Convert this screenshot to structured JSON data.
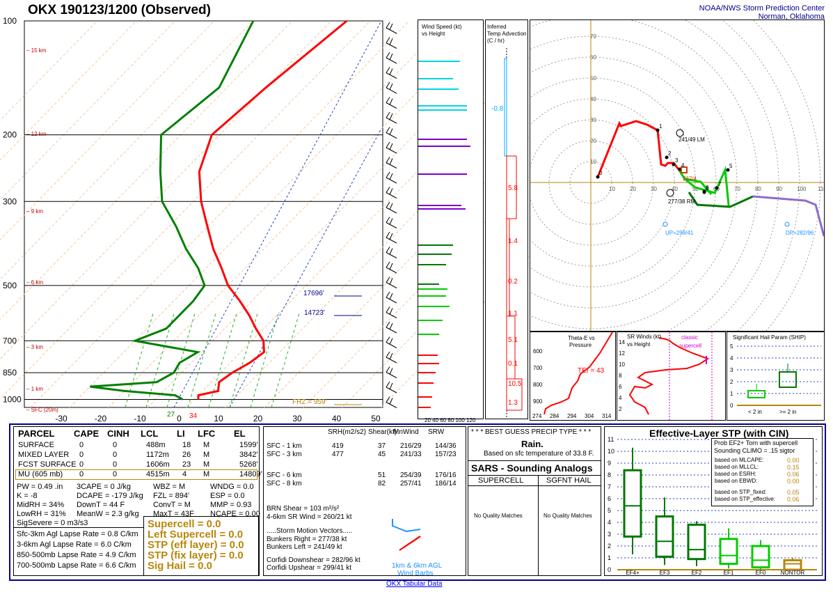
{
  "header": {
    "title": "OKX   190123/1200  (Observed)",
    "org_line1": "NOAA/NWS Storm Prediction Center",
    "org_line2": "Norman, Oklahoma"
  },
  "colors": {
    "temp": "#ff0000",
    "dewp": "#008000",
    "frame": "#00008b",
    "gold": "#b8860b"
  },
  "skewt": {
    "pressure_ticks": [
      "100",
      "200",
      "300",
      "500",
      "700",
      "850",
      "1000"
    ],
    "temp_ticks": [
      "-30",
      "-20",
      "-10",
      "0",
      "10",
      "20",
      "30",
      "40",
      "50"
    ],
    "height_labels": [
      "15 km",
      "12 km",
      "9 km",
      "6 km",
      "3 km",
      "1 km",
      "SFC (20m)"
    ],
    "surface_labels": {
      "dew": "27",
      "temp": "34"
    },
    "lines": {
      "a": "17696'",
      "b": "14723'",
      "frz": "FRZ = 959'"
    }
  },
  "chart_data": [
    {
      "type": "line",
      "title": "Skew-T log-P",
      "xlabel": "",
      "ylabel": "",
      "series": [
        {
          "name": "Temperature",
          "values": [
            [
              1000,
              1
            ],
            [
              975,
              0
            ],
            [
              950,
              4
            ],
            [
              925,
              3
            ],
            [
              900,
              2
            ],
            [
              850,
              3
            ],
            [
              800,
              5
            ],
            [
              750,
              6
            ],
            [
              700,
              3
            ],
            [
              650,
              -2
            ],
            [
              600,
              -7
            ],
            [
              550,
              -13
            ],
            [
              500,
              -20
            ],
            [
              450,
              -26
            ],
            [
              400,
              -33
            ],
            [
              350,
              -40
            ],
            [
              300,
              -48
            ],
            [
              250,
              -56
            ],
            [
              200,
              -62
            ],
            [
              150,
              -60
            ],
            [
              100,
              -56
            ]
          ]
        },
        {
          "name": "Dewpoint",
          "values": [
            [
              1000,
              -3
            ],
            [
              975,
              -6
            ],
            [
              950,
              -20
            ],
            [
              925,
              -30
            ],
            [
              900,
              -14
            ],
            [
              850,
              -12
            ],
            [
              800,
              -13
            ],
            [
              750,
              -11
            ],
            [
              700,
              -30
            ],
            [
              650,
              -25
            ],
            [
              600,
              -25
            ],
            [
              550,
              -25
            ],
            [
              500,
              -26
            ],
            [
              450,
              -32
            ],
            [
              400,
              -40
            ],
            [
              350,
              -48
            ],
            [
              300,
              -58
            ],
            [
              250,
              -66
            ],
            [
              200,
              -75
            ],
            [
              150,
              -72
            ],
            [
              100,
              -80
            ]
          ]
        }
      ]
    },
    {
      "type": "line",
      "title": "Hodograph",
      "series": [
        {
          "name": "Hodograph",
          "values": [
            [
              0,
              0
            ],
            [
              3,
              2
            ],
            [
              2,
              6
            ],
            [
              1,
              10
            ],
            [
              3,
              12
            ],
            [
              5,
              14
            ],
            [
              6,
              15
            ],
            [
              7,
              16
            ],
            [
              8,
              16
            ],
            [
              9,
              17
            ],
            [
              10,
              18
            ],
            [
              11,
              19
            ],
            [
              12,
              21
            ],
            [
              13,
              22
            ]
          ]
        }
      ]
    },
    {
      "type": "bar",
      "title": "Significant Hail Param (SHIP)",
      "categories": [
        "< 2 in",
        ">= 2 in"
      ],
      "values": [
        0.6,
        2.1
      ],
      "ylim": [
        0,
        5
      ]
    },
    {
      "type": "bar",
      "title": "Effective-Layer STP (with CIN)",
      "categories": [
        "EF4+",
        "EF3",
        "EF2",
        "EF1",
        "EF0",
        "NONTOR"
      ],
      "values": [
        5.4,
        2.4,
        1.7,
        1.2,
        0.8,
        0.5
      ],
      "ylim": [
        0,
        11
      ]
    }
  ],
  "wind_panel": {
    "title1": "Wind Speed (kt)",
    "title2": "vs Height",
    "axis": [
      "20",
      "40",
      "60",
      "80",
      "100",
      "120"
    ]
  },
  "adv_panel": {
    "title1": "Inferred",
    "title2": "Temp Advection",
    "title3": "(C / hr)",
    "values": [
      "-0.8",
      "5.8",
      "1.4",
      "0.2",
      "1.1",
      "5.1",
      "0.1",
      "10.5",
      "1.3"
    ]
  },
  "hodo": {
    "rings": [
      "10",
      "20",
      "30",
      "40",
      "50",
      "60",
      "70",
      "80",
      "90",
      "100",
      "110"
    ],
    "points": [
      "0",
      "1",
      "2",
      "3",
      "4",
      "5",
      "6",
      "7",
      "8"
    ],
    "lm": "241/49 LM",
    "rm": "277/38 RM",
    "mean": "262/4",
    "up": "UP=299/41",
    "dp": "DP=282/96"
  },
  "theta_panel": {
    "title1": "Theta-E vs",
    "title2": "Pressure",
    "tei": "TEI = 43",
    "yticks": [
      "600",
      "700",
      "800",
      "900"
    ],
    "xticks": [
      "274",
      "284",
      "294",
      "304",
      "314"
    ]
  },
  "srwind_panel": {
    "title1": "SR Winds (kt)",
    "title2": "vs Height",
    "classic": "classic",
    "supercell": "supercell",
    "yticks": [
      "14",
      "12",
      "10",
      "8",
      "6",
      "4",
      "2"
    ]
  },
  "ship_panel": {
    "title": "Significant Hail Param (SHIP)",
    "yticks": [
      "5",
      "4",
      "3",
      "2",
      "1",
      "0"
    ],
    "cats": [
      "< 2 in",
      ">= 2 in"
    ]
  },
  "parcel_table": {
    "headers": [
      "PARCEL",
      "CAPE",
      "CINH",
      "LCL",
      "LI",
      "LFC",
      "EL"
    ],
    "rows": [
      [
        "SURFACE",
        "0",
        "0",
        "488m",
        "18",
        "M",
        "1599'"
      ],
      [
        "MIXED LAYER",
        "0",
        "0",
        "1172m",
        "26",
        "M",
        "3842'"
      ],
      [
        "FCST SURFACE",
        "0",
        "0",
        "1606m",
        "23",
        "M",
        "5268'"
      ],
      [
        "MU   (605 mb)",
        "0",
        "0",
        "4515m",
        "4",
        "M",
        "14809'"
      ]
    ]
  },
  "indices": {
    "c1": [
      "PW = 0.49 .in",
      "K = -8",
      "MidRH = 34%",
      "LowRH = 31%",
      "SigSevere = 0 m3/s3"
    ],
    "c2": [
      "3CAPE = 0 J/kg",
      "DCAPE = -179 J/kg",
      "DownT = 44 F",
      "MeanW = 2.3 g/kg"
    ],
    "c3": [
      "WBZ = M",
      "FZL = 894'",
      "ConvT = M",
      "MaxT = 43F"
    ],
    "c4": [
      "WNDG = 0.0",
      "ESP = 0.0",
      "MMP = 0.93",
      "NCAPE = 0.00"
    ]
  },
  "lapse": [
    "Sfc-3km Agl Lapse Rate =   0.8 C/km",
    "3-6km Agl Lapse Rate =   6.0 C/km",
    "850-500mb Lapse Rate =   4.9 C/km",
    "700-500mb Lapse Rate =   6.6 C/km"
  ],
  "params_gold": [
    "Supercell = 0.0",
    "Left Supercell = 0.0",
    "STP (eff layer) = 0.0",
    "STP (fix layer) = 0.0",
    "Sig Hail = 0.0"
  ],
  "kinematics": {
    "headers": [
      "SRH(m2/s2)",
      "Shear(kt)",
      "MnWind",
      "SRW"
    ],
    "rows": [
      [
        "SFC - 1 km",
        "419",
        "37",
        "216/29",
        "144/36"
      ],
      [
        "SFC - 3 km",
        "477",
        "45",
        "241/33",
        "157/23"
      ],
      [
        "SFC - 6 km",
        "",
        "51",
        "254/39",
        "176/16"
      ],
      [
        "SFC - 8 km",
        "",
        "82",
        "257/41",
        "186/14"
      ]
    ],
    "brn": "BRN Shear =   103 m²/s²",
    "srwind": "4-6km SR Wind =        260/21 kt",
    "storm_hdr": ".....Storm Motion Vectors.....",
    "bunk_r": "Bunkers Right =           277/38 kt",
    "bunk_l": "Bunkers Left =             241/49 kt",
    "corf_d": "Corfidi Downshear =    282/96 kt",
    "corf_u": "Corfidi Upshear =        299/41 kt",
    "barbs1": "1km & 6km AGL",
    "barbs2": "Wind Barbs"
  },
  "precip": {
    "hdr": "* * * BEST GUESS PRECIP TYPE * * *",
    "type": "Rain.",
    "note": "Based on sfc temperature of 33.8 F."
  },
  "sars": {
    "title": "SARS - Sounding Analogs",
    "col1": "SUPERCELL",
    "col2": "SGFNT HAIL",
    "msg1": "No Quality Matches",
    "msg2": "No Quality Matches"
  },
  "stp": {
    "title": "Effective-Layer STP (with CIN)",
    "prob1": "Prob EF2+ Torn with supercell",
    "prob2": "Sounding CLIMO = .15 sigtor",
    "based": [
      [
        "based on MLCAPE:",
        "0.00"
      ],
      [
        "based on MLLCL:",
        "0.15"
      ],
      [
        "based on ESRH:",
        "0.06"
      ],
      [
        "based on EBWD:",
        "0.00"
      ],
      [
        "based on STP_fixed:",
        "0.05"
      ],
      [
        "based on STP_effective:",
        "0.06"
      ]
    ],
    "yticks": [
      "11",
      "10",
      "9",
      "8",
      "7",
      "6",
      "5",
      "4",
      "3",
      "2",
      "1",
      "0"
    ],
    "cats": [
      "EF4+",
      "EF3",
      "EF2",
      "EF1",
      "EF0",
      "NONTOR"
    ]
  },
  "footer": "OKX Tabular Data"
}
